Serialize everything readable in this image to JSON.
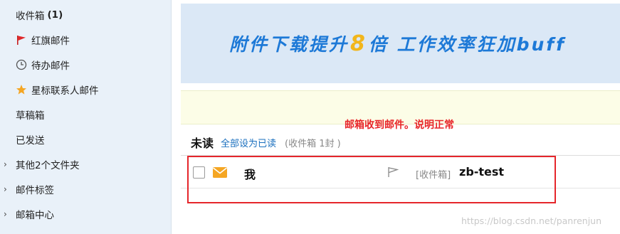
{
  "sidebar": {
    "inbox": {
      "label": "收件箱",
      "count": "(1)"
    },
    "items": [
      {
        "label": "红旗邮件",
        "icon": "red-flag-icon"
      },
      {
        "label": "待办邮件",
        "icon": "clock-icon"
      },
      {
        "label": "星标联系人邮件",
        "icon": "star-icon"
      },
      {
        "label": "草稿箱"
      },
      {
        "label": "已发送"
      },
      {
        "label": "其他2个文件夹",
        "expander": "›"
      },
      {
        "label": "邮件标签",
        "expander": "›"
      },
      {
        "label": "邮箱中心",
        "expander": "›"
      }
    ]
  },
  "banner": {
    "text_before": "附件下载提升",
    "number": "8",
    "text_after": "倍  工作效率狂加buff"
  },
  "annotation": "邮箱收到邮件。说明正常",
  "mail_list": {
    "section_title": "未读",
    "mark_all_read": "全部设为已读",
    "folder_hint_prefix": "(收件箱",
    "folder_hint_count": "1封",
    "folder_hint_suffix": ")",
    "rows": [
      {
        "sender": "我",
        "folder": "[收件箱]",
        "subject": "zb-test",
        "unread": true
      }
    ]
  },
  "watermark": "https://blog.csdn.net/panrenjun",
  "colors": {
    "accent": "#1a6fbe",
    "annotation": "#e8262a",
    "sidebar_bg": "#e9f1f9",
    "banner_bg": "#dbe8f6"
  }
}
